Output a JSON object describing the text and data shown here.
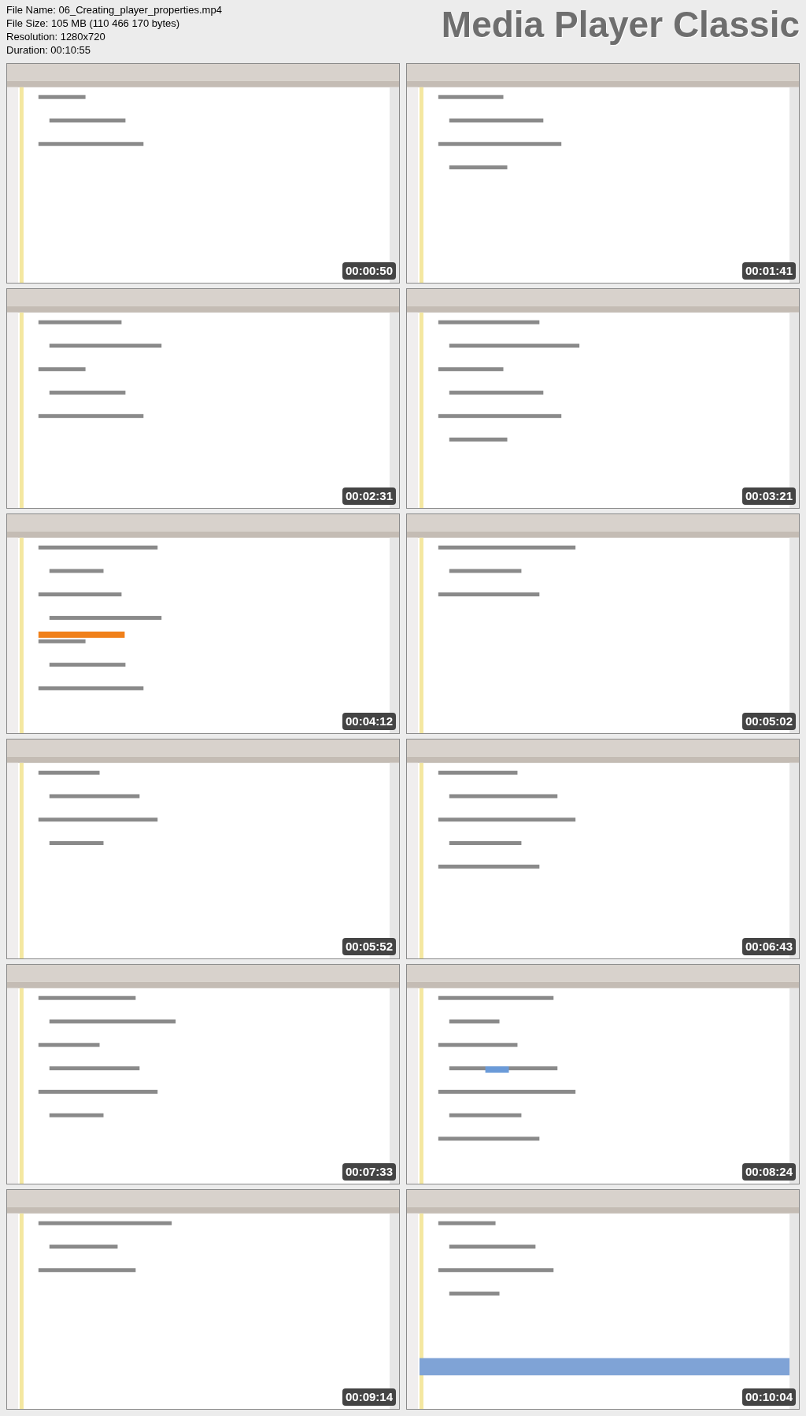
{
  "header": {
    "lines": [
      "File Name: 06_Creating_player_properties.mp4",
      "File Size: 105 MB (110 466 170 bytes)",
      "Resolution: 1280x720",
      "Duration: 00:10:55"
    ]
  },
  "brand": "Media Player Classic",
  "frames": [
    {
      "kind": "picture",
      "timestamp": "00:00:50"
    },
    {
      "kind": "picture",
      "timestamp": "00:01:41"
    },
    {
      "kind": "picture",
      "timestamp": "00:02:31"
    },
    {
      "kind": "picture",
      "timestamp": "00:03:21"
    },
    {
      "kind": "picture",
      "timestamp": "00:04:12"
    },
    {
      "kind": "picture",
      "timestamp": "00:05:02"
    },
    {
      "kind": "picture",
      "timestamp": "00:05:52"
    },
    {
      "kind": "picture",
      "timestamp": "00:06:43"
    },
    {
      "kind": "picture",
      "timestamp": "00:07:33"
    },
    {
      "kind": "picture",
      "timestamp": "00:08:24"
    },
    {
      "kind": "picture",
      "timestamp": "00:09:14"
    },
    {
      "kind": "picture",
      "timestamp": "00:10:04"
    }
  ]
}
